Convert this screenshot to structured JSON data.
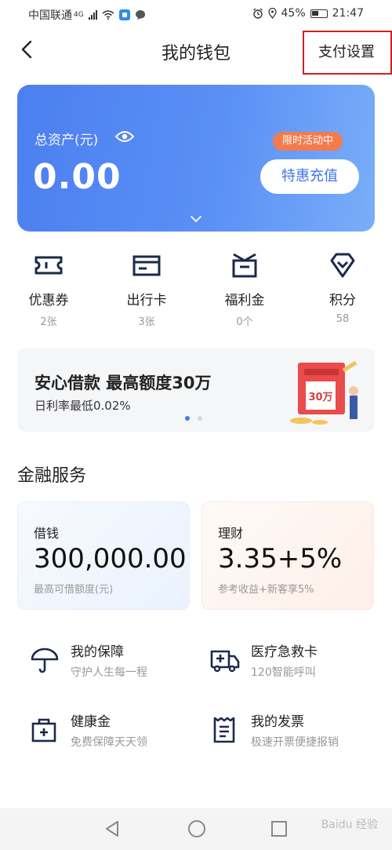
{
  "status_bar": {
    "carrier": "中国联通",
    "network": "4G",
    "battery": "45%",
    "time": "21:47"
  },
  "header": {
    "title": "我的钱包",
    "pay_settings": "支付设置"
  },
  "asset_card": {
    "label": "总资产(元)",
    "value": "0.00",
    "promo_tag": "限时活动中",
    "recharge_button": "特惠充值"
  },
  "quick_actions": [
    {
      "label": "优惠券",
      "count": "2张",
      "icon": "coupon-icon"
    },
    {
      "label": "出行卡",
      "count": "3张",
      "icon": "card-icon"
    },
    {
      "label": "福利金",
      "count": "0个",
      "icon": "gift-box-icon"
    },
    {
      "label": "积分",
      "count": "58",
      "icon": "diamond-icon"
    }
  ],
  "loan_banner": {
    "title": "安心借款 最高额度30万",
    "subtitle": "日利率最低0.02%",
    "illustration_text": "30万"
  },
  "finance": {
    "section_title": "金融服务",
    "cards": [
      {
        "label": "借钱",
        "value": "300,000.00",
        "note": "最高可借额度(元)"
      },
      {
        "label": "理财",
        "value": "3.35+5%",
        "note": "参考收益+新客享5%"
      }
    ]
  },
  "services": [
    {
      "title": "我的保障",
      "subtitle": "守护人生每一程",
      "icon": "umbrella-icon"
    },
    {
      "title": "医疗急救卡",
      "subtitle": "120智能呼叫",
      "icon": "ambulance-icon"
    },
    {
      "title": "健康金",
      "subtitle": "免费保障天天领",
      "icon": "medical-kit-icon"
    },
    {
      "title": "我的发票",
      "subtitle": "极速开票便捷报销",
      "icon": "invoice-icon"
    }
  ],
  "watermark": "Baidu 经验",
  "colors": {
    "accent": "#3f75ea",
    "promo": "#f37b4d",
    "highlight_box": "#d02020"
  }
}
